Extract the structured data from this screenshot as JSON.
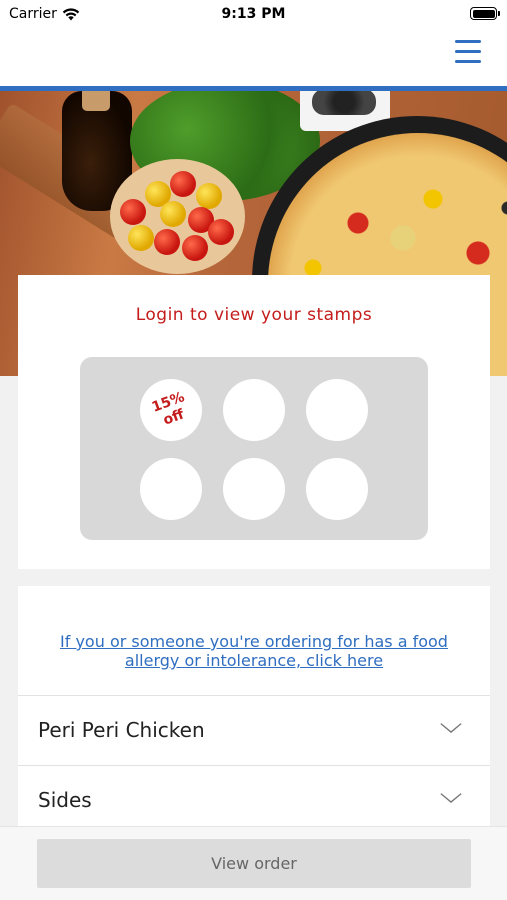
{
  "status_bar": {
    "carrier": "Carrier",
    "time": "9:13 PM"
  },
  "header": {
    "menu_icon": "hamburger-menu-icon",
    "accent_color": "#2f6ec0"
  },
  "stamp_card": {
    "title": "Login to view your stamps",
    "reward_line1": "15%",
    "reward_line2": "off",
    "total_stamps": 6,
    "title_color": "#c41c1c"
  },
  "allergy": {
    "link_text": "If you or someone you're ordering for has a food allergy or intolerance, click here"
  },
  "sections": [
    {
      "label": "Peri Peri Chicken",
      "icon": "chevron-down-icon"
    },
    {
      "label": "Sides",
      "icon": "chevron-down-icon"
    }
  ],
  "bottom_bar": {
    "view_order_label": "View order"
  }
}
